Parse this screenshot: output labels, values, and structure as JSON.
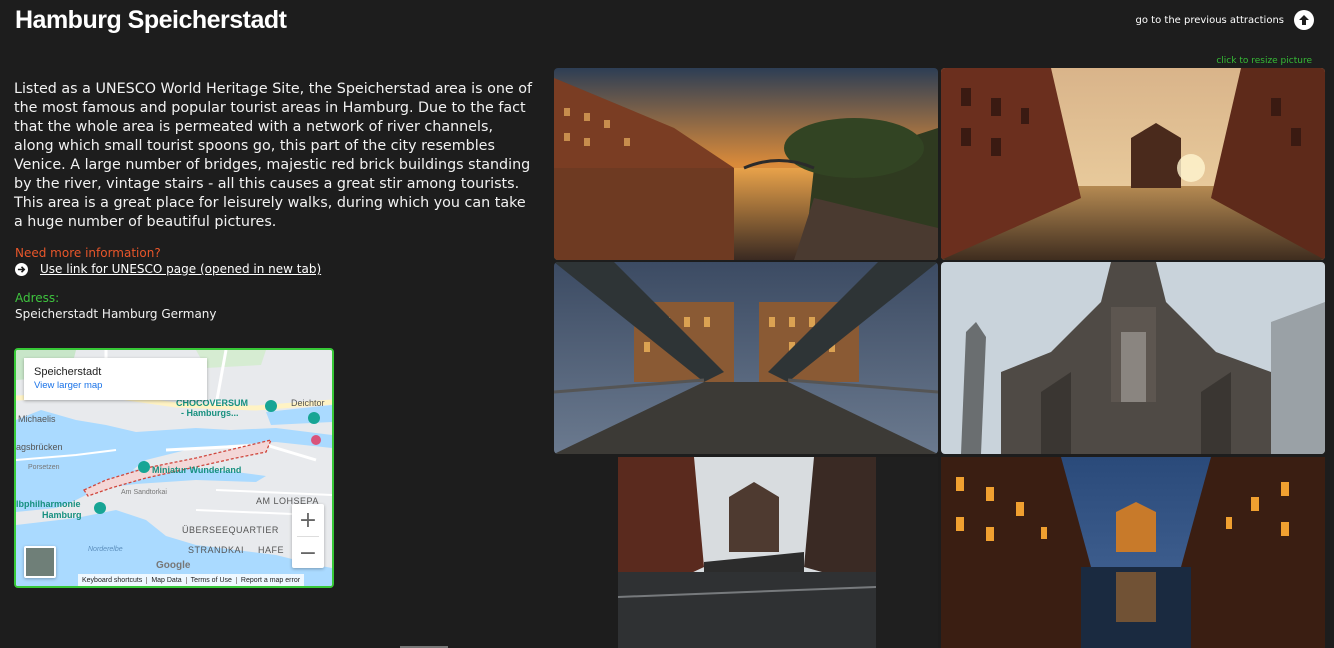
{
  "page": {
    "title": "Hamburg Speicherstadt",
    "prev_link_label": "go to the previous attractions",
    "resize_hint": "click to resize picture"
  },
  "description": "Listed as a UNESCO World Heritage Site, the Speicherstad area is one of the most famous and popular tourist areas in Hamburg. Due to the fact that the whole area is permeated with a network of river channels, along which small tourist spoons go, this part of the city resembles Venice. A large number of bridges, majestic red brick buildings standing by the river, vintage stairs - all this causes a great stir among tourists. This area is a great place for leisurely walks, during which you can take a huge number of beautiful pictures.",
  "info": {
    "need_more": "Need more information?",
    "unesco_link": "Use link for UNESCO page (opened in new tab)",
    "adress_label": "Adress:",
    "adress_value": "Speicherstadt Hamburg Germany"
  },
  "map": {
    "place": "Speicherstadt",
    "view_larger": "View larger map",
    "zoom_in": "+",
    "zoom_out": "−",
    "google": "Google",
    "attribution": [
      "Keyboard shortcuts",
      "Map Data",
      "Terms of Use",
      "Report a map error"
    ],
    "labels": {
      "michaelis": "Michaelis",
      "chocoversum": "CHOCOVERSUM",
      "chocoversum2": "- Hamburgs...",
      "deichtor": "Deichtor",
      "landungsbrucken": "agsbrücken",
      "miniatur": "Miniatur Wunderland",
      "elbphilharmonie": "lbphilharmonie",
      "hamburg": "Hamburg",
      "am_lohsepark": "AM LOHSEPA",
      "uberseequartier": "ÜBERSEEQUARTIER",
      "strandkai": "STRANDKAI",
      "hafen": "HAFE",
      "porsetzen": "Porsetzen",
      "am_sandtorkai": "Am Sandtorkai",
      "norderelbe": "Norderelbe"
    }
  },
  "gallery": [
    {
      "name": "photo-canal-sunset"
    },
    {
      "name": "photo-wasserschloss-sunset"
    },
    {
      "name": "photo-bridge-night"
    },
    {
      "name": "photo-church-ruin"
    },
    {
      "name": "photo-wasserschloss-day"
    },
    {
      "name": "photo-canal-night"
    }
  ],
  "colors": {
    "background": "#1d1d1d",
    "accent_orange": "#e8562a",
    "accent_green": "#3ec43e",
    "map_border": "#37c837"
  },
  "icons": {
    "prev": "arrow-up-circle-icon",
    "link": "arrow-right-circle-icon"
  }
}
